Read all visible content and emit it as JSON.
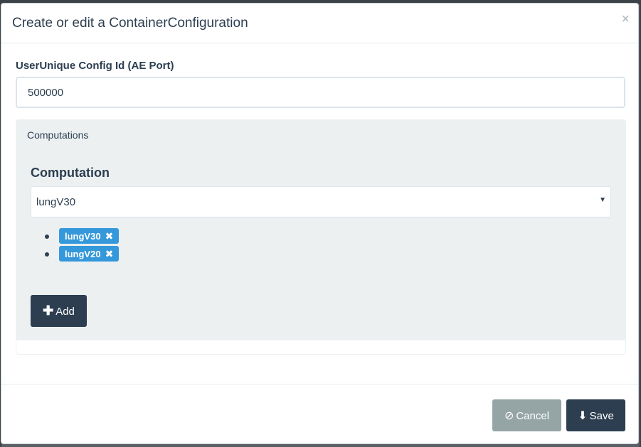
{
  "modal": {
    "title": "Create or edit a ContainerConfiguration",
    "close_glyph": "×"
  },
  "form": {
    "config_id_label": "UserUnique Config Id (AE Port)",
    "config_id_value": "500000"
  },
  "computations_panel": {
    "heading": "Computations",
    "computation_label": "Computation",
    "selected_computation": "lungV30",
    "tags": [
      {
        "label": "lungV30",
        "remove_glyph": "✖"
      },
      {
        "label": "lungV20",
        "remove_glyph": "✖"
      }
    ],
    "add_button": {
      "icon": "plus-icon",
      "glyph": "✚",
      "label": "Add"
    }
  },
  "footer": {
    "cancel_button": {
      "icon": "ban-icon",
      "glyph": "⊘",
      "label": "Cancel"
    },
    "save_button": {
      "icon": "download-icon",
      "glyph": "⬇",
      "label": "Save"
    }
  },
  "colors": {
    "primary": "#2c3e50",
    "tag": "#3498db",
    "cancel": "#95a5a6",
    "panel_bg": "#ecf0f1"
  }
}
